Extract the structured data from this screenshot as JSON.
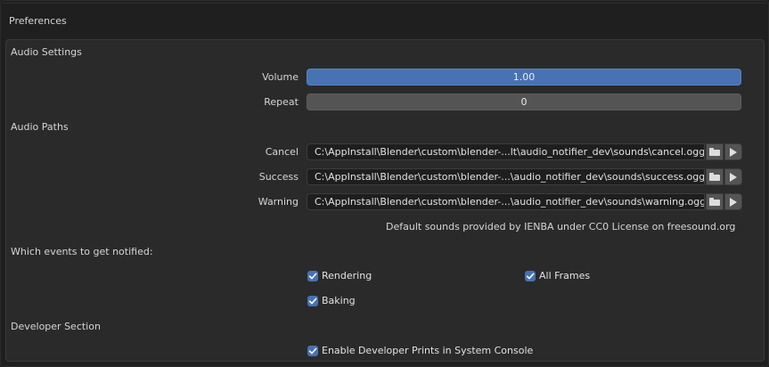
{
  "header": {
    "title": "Preferences"
  },
  "audio_settings": {
    "section_label": "Audio Settings",
    "volume": {
      "label": "Volume",
      "value": "1.00"
    },
    "repeat": {
      "label": "Repeat",
      "value": "0"
    }
  },
  "audio_paths": {
    "section_label": "Audio Paths",
    "cancel": {
      "label": "Cancel",
      "value": "C:\\AppInstall\\Blender\\custom\\blender-...lt\\audio_notifier_dev\\sounds\\cancel.ogg"
    },
    "success": {
      "label": "Success",
      "value": "C:\\AppInstall\\Blender\\custom\\blender-...\\audio_notifier_dev\\sounds\\success.ogg"
    },
    "warning": {
      "label": "Warning",
      "value": "C:\\AppInstall\\Blender\\custom\\blender-...\\audio_notifier_dev\\sounds\\warning.ogg"
    },
    "note": "Default sounds provided by IENBA under CC0 License on freesound.org"
  },
  "events": {
    "section_label": "Which events to get notified:",
    "rendering": {
      "label": "Rendering",
      "checked": true
    },
    "all_frames": {
      "label": "All Frames",
      "checked": true
    },
    "baking": {
      "label": "Baking",
      "checked": true
    }
  },
  "developer": {
    "section_label": "Developer Section",
    "prints": {
      "label": "Enable Developer Prints in System Console",
      "checked": true
    }
  },
  "icons": {
    "folder": "folder-icon",
    "play": "play-icon",
    "check": "check-icon"
  },
  "colors": {
    "accent": "#4772b3",
    "panel": "#2a2a2a",
    "background": "#1d1d1d"
  }
}
